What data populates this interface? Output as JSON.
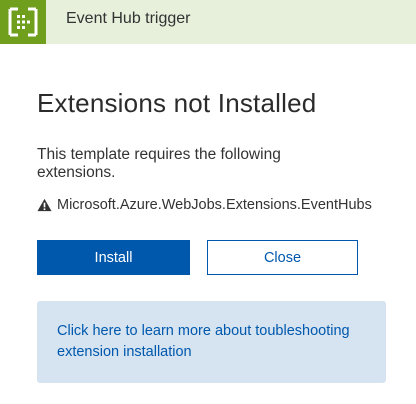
{
  "header": {
    "title": "Event Hub trigger",
    "icon": "event-hub-icon",
    "icon_bg": "#6f9f1c",
    "bg": "#e6f0db"
  },
  "dialog": {
    "title": "Extensions not Installed",
    "description": "This template requires the following extensions.",
    "extension_name": "Microsoft.Azure.WebJobs.Extensions.EventHubs",
    "warning_icon": "warning-icon"
  },
  "buttons": {
    "install_label": "Install",
    "close_label": "Close",
    "accent": "#0058ad"
  },
  "info": {
    "link_text": "Click here to learn more about toubleshooting extension installation",
    "bg": "#d6e4f1"
  }
}
